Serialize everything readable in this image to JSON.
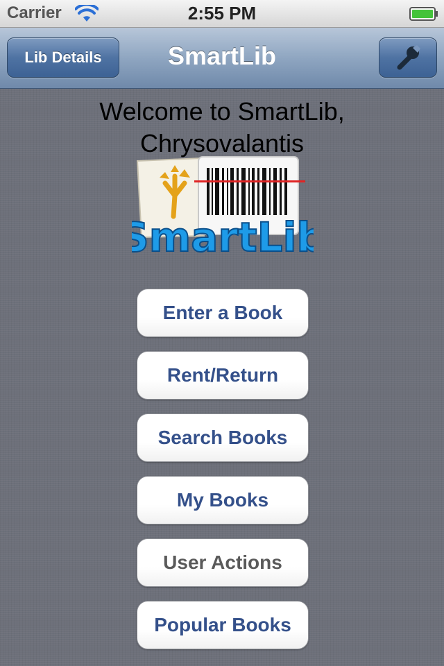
{
  "status_bar": {
    "carrier": "Carrier",
    "time": "2:55 PM",
    "wifi_icon": "wifi-icon",
    "battery_icon": "battery-full-icon",
    "battery_color": "#44c33a"
  },
  "nav_bar": {
    "title": "SmartLib",
    "left_button_label": "Lib Details",
    "right_button_icon": "wrench-icon"
  },
  "welcome": {
    "line1": "Welcome to SmartLib,",
    "line2": "Chrysovalantis"
  },
  "logo": {
    "text": "SmartLib",
    "color": "#1e9be8"
  },
  "menu": {
    "enter_book": "Enter a Book",
    "rent_return": "Rent/Return",
    "search_books": "Search Books",
    "my_books": "My Books",
    "user_actions": "User Actions",
    "popular_books": "Popular Books"
  },
  "colors": {
    "button_text": "#34508a",
    "button_text_disabled": "#5a5a5a",
    "nav_bar": "#8fa6c1"
  }
}
